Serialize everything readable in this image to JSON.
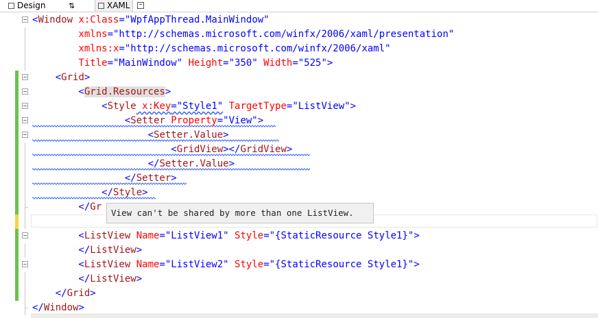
{
  "tabs": {
    "design": "Design",
    "swap_glyph": "⇅",
    "xaml": "XAML"
  },
  "lines": [
    [
      {
        "c": "st",
        "t": "<"
      },
      {
        "c": "el",
        "t": "Window"
      },
      {
        "c": "at",
        "t": " x:Class"
      },
      {
        "c": "st",
        "t": "=\"WpfAppThread.MainWindow\""
      }
    ],
    [
      {
        "c": "at",
        "t": "        xmlns"
      },
      {
        "c": "st",
        "t": "=\"http://schemas.microsoft.com/winfx/2006/xaml/presentation\""
      }
    ],
    [
      {
        "c": "at",
        "t": "        xmlns:x"
      },
      {
        "c": "st",
        "t": "=\"http://schemas.microsoft.com/winfx/2006/xaml\""
      }
    ],
    [
      {
        "c": "at",
        "t": "        Title"
      },
      {
        "c": "st",
        "t": "=\"MainWindow\""
      },
      {
        "c": "at",
        "t": " Height"
      },
      {
        "c": "st",
        "t": "=\"350\""
      },
      {
        "c": "at",
        "t": " Width"
      },
      {
        "c": "st",
        "t": "=\"525\">"
      }
    ],
    [
      {
        "c": "st",
        "t": "    <"
      },
      {
        "c": "el",
        "t": "Grid"
      },
      {
        "c": "st",
        "t": ">"
      }
    ],
    [
      {
        "c": "st",
        "t": "        <"
      },
      {
        "c": "el hl",
        "t": "Grid.Resources"
      },
      {
        "c": "st",
        "t": ">"
      }
    ],
    [
      {
        "c": "st",
        "t": "            <"
      },
      {
        "c": "el",
        "t": "Style"
      },
      {
        "c": "at squig",
        "t": " x:Key"
      },
      {
        "c": "st squig",
        "t": "=\"Style1\""
      },
      {
        "c": "at",
        "t": " TargetType"
      },
      {
        "c": "st",
        "t": "=\"ListView\">"
      }
    ],
    [
      {
        "c": "st",
        "t": "                <"
      },
      {
        "c": "el",
        "t": "Setter"
      },
      {
        "c": "at",
        "t": " Property"
      },
      {
        "c": "st",
        "t": "=\"View\">"
      }
    ],
    [
      {
        "c": "st",
        "t": "                    <"
      },
      {
        "c": "el",
        "t": "Setter.Value"
      },
      {
        "c": "st",
        "t": ">"
      }
    ],
    [
      {
        "c": "st",
        "t": "                        <"
      },
      {
        "c": "el",
        "t": "GridView"
      },
      {
        "c": "st",
        "t": "></"
      },
      {
        "c": "el",
        "t": "GridView"
      },
      {
        "c": "st",
        "t": ">"
      }
    ],
    [
      {
        "c": "st",
        "t": "                    </"
      },
      {
        "c": "el",
        "t": "Setter.Value"
      },
      {
        "c": "st",
        "t": ">"
      }
    ],
    [
      {
        "c": "st",
        "t": "                </"
      },
      {
        "c": "el",
        "t": "Setter"
      },
      {
        "c": "st",
        "t": ">"
      }
    ],
    [
      {
        "c": "st",
        "t": "            </"
      },
      {
        "c": "el",
        "t": "Style"
      },
      {
        "c": "st",
        "t": ">"
      }
    ],
    [
      {
        "c": "st",
        "t": "        </"
      },
      {
        "c": "el",
        "t": "Gr"
      }
    ],
    [],
    [
      {
        "c": "st",
        "t": "        <"
      },
      {
        "c": "el",
        "t": "ListView"
      },
      {
        "c": "at",
        "t": " Name"
      },
      {
        "c": "st",
        "t": "=\"ListView1\""
      },
      {
        "c": "at",
        "t": " Style"
      },
      {
        "c": "st",
        "t": "=\"{StaticResource Style1}\">"
      }
    ],
    [
      {
        "c": "st",
        "t": "        </"
      },
      {
        "c": "el",
        "t": "ListView"
      },
      {
        "c": "st",
        "t": ">"
      }
    ],
    [
      {
        "c": "st",
        "t": "        <"
      },
      {
        "c": "el",
        "t": "ListView"
      },
      {
        "c": "at",
        "t": " Name"
      },
      {
        "c": "st",
        "t": "=\"ListView2\""
      },
      {
        "c": "at",
        "t": " Style"
      },
      {
        "c": "st",
        "t": "=\"{StaticResource Style1}\">"
      }
    ],
    [
      {
        "c": "st",
        "t": "        </"
      },
      {
        "c": "el",
        "t": "ListView"
      },
      {
        "c": "st",
        "t": ">"
      }
    ],
    [
      {
        "c": "st",
        "t": "    </"
      },
      {
        "c": "el",
        "t": "Grid"
      },
      {
        "c": "st",
        "t": ">"
      }
    ],
    [
      {
        "c": "st",
        "t": "</"
      },
      {
        "c": "el",
        "t": "Window"
      },
      {
        "c": "st",
        "t": ">"
      }
    ]
  ],
  "tooltip": "View can't be shared by more than one ListView."
}
